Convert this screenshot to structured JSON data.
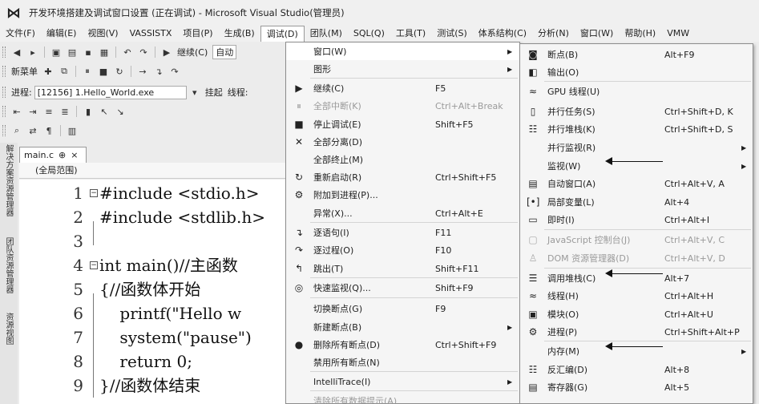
{
  "window": {
    "title": "开发环境搭建及调试窗口设置 (正在调试) - Microsoft Visual Studio(管理员)"
  },
  "menubar": [
    "文件(F)",
    "编辑(E)",
    "视图(V)",
    "VASSISTX",
    "项目(P)",
    "生成(B)",
    "调试(D)",
    "团队(M)",
    "SQL(Q)",
    "工具(T)",
    "测试(S)",
    "体系结构(C)",
    "分析(N)",
    "窗口(W)",
    "帮助(H)",
    "VMW"
  ],
  "toolbar": {
    "continue_label": "继续(C)",
    "config_value": "自动",
    "new_item": "新菜单",
    "process_label": "进程:",
    "process_value": "[12156] 1.Hello_World.exe",
    "suspend_label": "挂起",
    "thread_label": "线程:"
  },
  "side_tabs": [
    "解决方案资源管理器",
    "团队资源管理器",
    "资源视图"
  ],
  "editor": {
    "tab_name": "main.c",
    "tab_pin": "⊕",
    "tab_close": "×",
    "scope": "(全局范围)",
    "lines": [
      {
        "num": "1",
        "text": "#include <stdio.h>"
      },
      {
        "num": "2",
        "text": "#include <stdlib.h>"
      },
      {
        "num": "3",
        "text": ""
      },
      {
        "num": "4",
        "text": "int main()//主函数"
      },
      {
        "num": "5",
        "text": "{//函数体开始"
      },
      {
        "num": "6",
        "text": "    printf(\"Hello w"
      },
      {
        "num": "7",
        "text": "    system(\"pause\")"
      },
      {
        "num": "8",
        "text": "    return 0;"
      },
      {
        "num": "9",
        "text": "}//函数体结束"
      }
    ]
  },
  "debug_menu": [
    {
      "label": "窗口(W)",
      "shortcut": "",
      "icon": "",
      "submenu": true,
      "highlight": true
    },
    {
      "label": "图形",
      "shortcut": "",
      "icon": "",
      "submenu": true
    },
    {
      "label": "继续(C)",
      "shortcut": "F5",
      "icon": "▶"
    },
    {
      "label": "全部中断(K)",
      "shortcut": "Ctrl+Alt+Break",
      "icon": "⏸",
      "disabled": true
    },
    {
      "label": "停止调试(E)",
      "shortcut": "Shift+F5",
      "icon": "■"
    },
    {
      "label": "全部分离(D)",
      "shortcut": "",
      "icon": "✕"
    },
    {
      "label": "全部终止(M)",
      "shortcut": "",
      "icon": ""
    },
    {
      "label": "重新启动(R)",
      "shortcut": "Ctrl+Shift+F5",
      "icon": "↻"
    },
    {
      "label": "附加到进程(P)...",
      "shortcut": "",
      "icon": "⚙"
    },
    {
      "label": "异常(X)...",
      "shortcut": "Ctrl+Alt+E",
      "icon": ""
    },
    {
      "label": "逐语句(I)",
      "shortcut": "F11",
      "icon": "↴"
    },
    {
      "label": "逐过程(O)",
      "shortcut": "F10",
      "icon": "↷"
    },
    {
      "label": "跳出(T)",
      "shortcut": "Shift+F11",
      "icon": "↰"
    },
    {
      "label": "快速监视(Q)...",
      "shortcut": "Shift+F9",
      "icon": "◎"
    },
    {
      "label": "切换断点(G)",
      "shortcut": "F9",
      "icon": ""
    },
    {
      "label": "新建断点(B)",
      "shortcut": "",
      "icon": "",
      "submenu": true
    },
    {
      "label": "删除所有断点(D)",
      "shortcut": "Ctrl+Shift+F9",
      "icon": "●"
    },
    {
      "label": "禁用所有断点(N)",
      "shortcut": "",
      "icon": ""
    },
    {
      "label": "IntelliTrace(I)",
      "shortcut": "",
      "icon": "",
      "submenu": true
    },
    {
      "label": "清除所有数据提示(A)",
      "shortcut": "",
      "icon": "",
      "disabled": true
    }
  ],
  "window_submenu": [
    {
      "label": "断点(B)",
      "shortcut": "Alt+F9",
      "icon": "◙"
    },
    {
      "label": "输出(O)",
      "shortcut": "",
      "icon": "◧"
    },
    {
      "label": "GPU 线程(U)",
      "shortcut": "",
      "icon": "≈"
    },
    {
      "label": "并行任务(S)",
      "shortcut": "Ctrl+Shift+D, K",
      "icon": "▯"
    },
    {
      "label": "并行堆栈(K)",
      "shortcut": "Ctrl+Shift+D, S",
      "icon": "☷"
    },
    {
      "label": "并行监视(R)",
      "shortcut": "",
      "icon": "",
      "submenu": true
    },
    {
      "label": "监视(W)",
      "shortcut": "",
      "icon": "",
      "submenu": true,
      "annotated": true
    },
    {
      "label": "自动窗口(A)",
      "shortcut": "Ctrl+Alt+V, A",
      "icon": "▤"
    },
    {
      "label": "局部变量(L)",
      "shortcut": "Alt+4",
      "icon": "[•]"
    },
    {
      "label": "即时(I)",
      "shortcut": "Ctrl+Alt+I",
      "icon": "▭"
    },
    {
      "label": "JavaScript 控制台(J)",
      "shortcut": "Ctrl+Alt+V, C",
      "icon": "▢",
      "disabled": true
    },
    {
      "label": "DOM 资源管理器(D)",
      "shortcut": "Ctrl+Alt+V, D",
      "icon": "♙",
      "disabled": true
    },
    {
      "label": "调用堆栈(C)",
      "shortcut": "Alt+7",
      "icon": "☰",
      "annotated": true
    },
    {
      "label": "线程(H)",
      "shortcut": "Ctrl+Alt+H",
      "icon": "≈"
    },
    {
      "label": "模块(O)",
      "shortcut": "Ctrl+Alt+U",
      "icon": "▣"
    },
    {
      "label": "进程(P)",
      "shortcut": "Ctrl+Shift+Alt+P",
      "icon": "⚙"
    },
    {
      "label": "内存(M)",
      "shortcut": "",
      "icon": "",
      "submenu": true,
      "annotated": true
    },
    {
      "label": "反汇编(D)",
      "shortcut": "Alt+8",
      "icon": "☷"
    },
    {
      "label": "寄存器(G)",
      "shortcut": "Alt+5",
      "icon": "▤"
    }
  ],
  "symbols": {
    "submenu_arrow": "▶",
    "annotation_arrow": "⟵"
  },
  "colors": {
    "menu_bg": "#f5f5f5",
    "highlight": "#ffffff",
    "disabled": "#9a9a9a"
  }
}
